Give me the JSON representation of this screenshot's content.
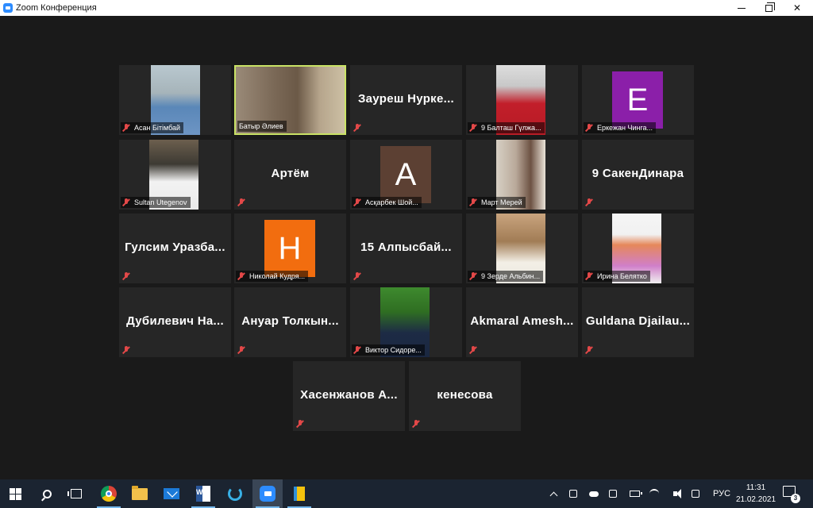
{
  "window": {
    "title": "Zoom Конференция"
  },
  "participants": [
    {
      "name": "Асан Бітімбай",
      "row": 0,
      "col": 0,
      "kind": "video",
      "photo": "p1"
    },
    {
      "name": "Батыр Әлиев",
      "row": 0,
      "col": 1,
      "kind": "video",
      "photo": "p2",
      "active": true,
      "muted": false
    },
    {
      "name": "Зауреш Нурке...",
      "row": 0,
      "col": 2,
      "kind": "text"
    },
    {
      "name": "9 Балташ Гүлжа...",
      "row": 0,
      "col": 3,
      "kind": "video",
      "photo": "p3"
    },
    {
      "name": "Еркежан Чинга...",
      "row": 0,
      "col": 4,
      "kind": "avatar",
      "letter": "E",
      "color": "#8b1fa9"
    },
    {
      "name": "Sultan Utegenov",
      "row": 1,
      "col": 0,
      "kind": "video",
      "photo": "p4"
    },
    {
      "name": "Артём",
      "row": 1,
      "col": 1,
      "kind": "text"
    },
    {
      "name": "Асқарбек Шой...",
      "row": 1,
      "col": 2,
      "kind": "avatar",
      "letter": "A",
      "color": "#5c4033"
    },
    {
      "name": "Март Мерей",
      "row": 1,
      "col": 3,
      "kind": "video",
      "photo": "p5"
    },
    {
      "name": "9 СакенДинара",
      "row": 1,
      "col": 4,
      "kind": "text"
    },
    {
      "name": "Гулсим Уразба...",
      "row": 2,
      "col": 0,
      "kind": "text"
    },
    {
      "name": "Николай Кудря...",
      "row": 2,
      "col": 1,
      "kind": "avatar",
      "letter": "H",
      "color": "#f26d0f"
    },
    {
      "name": "15 Алпысбай...",
      "row": 2,
      "col": 2,
      "kind": "text"
    },
    {
      "name": "9 Зерде Альбин...",
      "row": 2,
      "col": 3,
      "kind": "video",
      "photo": "p6"
    },
    {
      "name": "Ирина Белятко",
      "row": 2,
      "col": 4,
      "kind": "video",
      "photo": "p7"
    },
    {
      "name": "Дубилевич На...",
      "row": 3,
      "col": 0,
      "kind": "text"
    },
    {
      "name": "Ануар Толкын...",
      "row": 3,
      "col": 1,
      "kind": "text"
    },
    {
      "name": "Виктор Сидоре...",
      "row": 3,
      "col": 2,
      "kind": "video",
      "photo": "p8"
    },
    {
      "name": "Akmaral Amesh...",
      "row": 3,
      "col": 3,
      "kind": "text"
    },
    {
      "name": "Guldana Djailau...",
      "row": 3,
      "col": 4,
      "kind": "text"
    },
    {
      "name": "Хасенжанов А...",
      "row": 4,
      "col": 0,
      "kind": "text"
    },
    {
      "name": "кенесова",
      "row": 4,
      "col": 1,
      "kind": "text"
    }
  ],
  "taskbar": {
    "apps": [
      "start-icon",
      "search-icon",
      "task-view-icon",
      "chrome-icon",
      "file-explorer-icon",
      "mail-icon",
      "word-icon",
      "cortana-ring-icon",
      "zoom-icon",
      "document-app-icon"
    ],
    "language": "РУС",
    "time": "11:31",
    "date": "21.02.2021",
    "notification_count": "3"
  },
  "colors": {
    "active_speaker_border": "#c9e265",
    "tile_bg": "#262626",
    "stage_bg": "#1a1a1a",
    "muted_icon": "#e34848"
  }
}
